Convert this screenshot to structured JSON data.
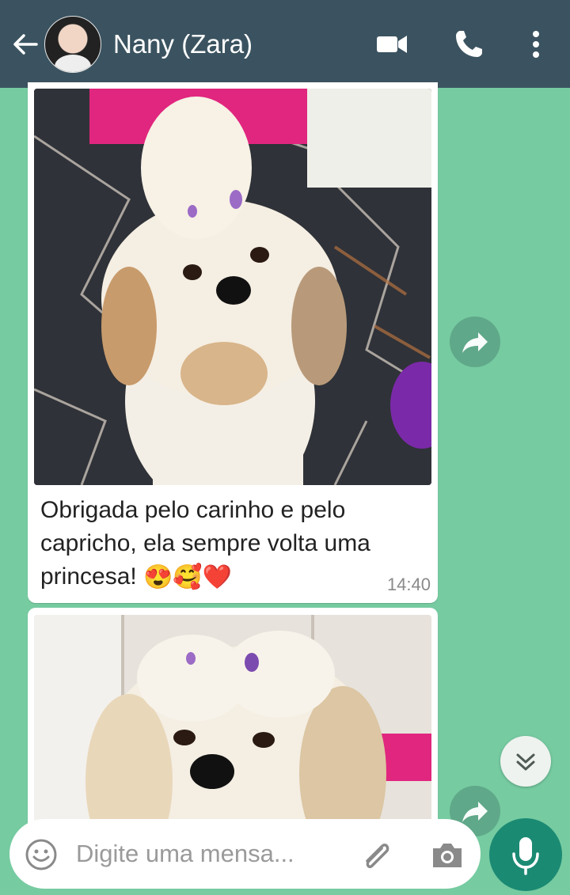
{
  "header": {
    "title": "Nany (Zara)",
    "back_icon": "arrow-left-icon",
    "video_icon": "video-call-icon",
    "call_icon": "phone-icon",
    "menu_icon": "more-vertical-icon",
    "bg_color": "#3b5360"
  },
  "chat": {
    "background_color": "#76cba1",
    "messages": [
      {
        "type": "image-with-caption",
        "caption_text": "Obrigada pelo carinho e pelo capricho, ela sempre volta uma princesa!",
        "caption_emojis": "😍🥰❤️",
        "time": "14:40"
      },
      {
        "type": "image"
      }
    ]
  },
  "composer": {
    "placeholder": "Digite uma mensa...",
    "emoji_icon": "emoji-icon",
    "attach_icon": "paperclip-icon",
    "camera_icon": "camera-icon",
    "mic_icon": "microphone-icon",
    "accent_color": "#1b8a73"
  }
}
